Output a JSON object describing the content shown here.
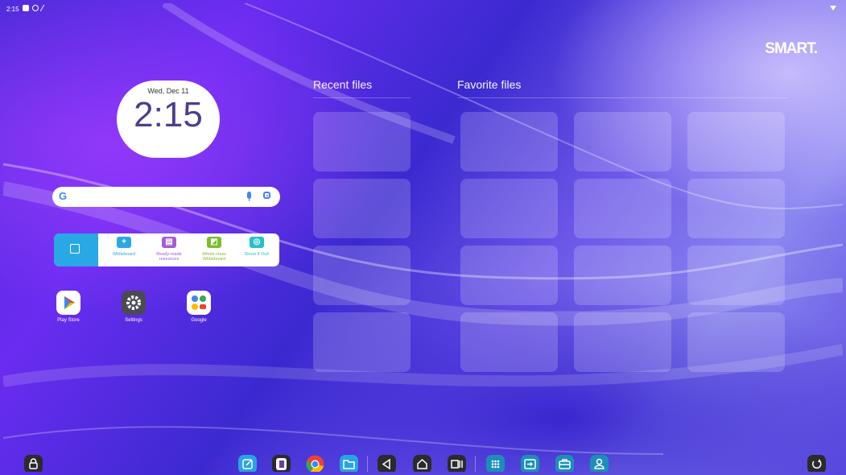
{
  "status_bar": {
    "time": "2:15"
  },
  "brand": "SMART.",
  "clock": {
    "date": "Wed, Dec 11",
    "time": "2:15"
  },
  "search": {
    "logo_letter": "G"
  },
  "smart_widget": {
    "items": [
      {
        "label": "Whiteboard",
        "color": "#2aa8e6",
        "glyph": "+"
      },
      {
        "label": "Ready-made resources",
        "color": "#a55bd8",
        "glyph": "▤"
      },
      {
        "label": "Whole-class Whiteboard",
        "color": "#7cbd2b",
        "glyph": "◩"
      },
      {
        "label": "Shout It Out!",
        "color": "#26c1c6",
        "glyph": "◎"
      }
    ]
  },
  "apps": [
    {
      "label": "Play Store"
    },
    {
      "label": "Settings"
    },
    {
      "label": "Google"
    }
  ],
  "sections": {
    "recent": "Recent files",
    "favorite": "Favorite files"
  },
  "colors": {
    "dock_blue": "#29a3e3",
    "dock_teal": "#1c8fb8",
    "dock_dark": "#2b2b2b"
  }
}
